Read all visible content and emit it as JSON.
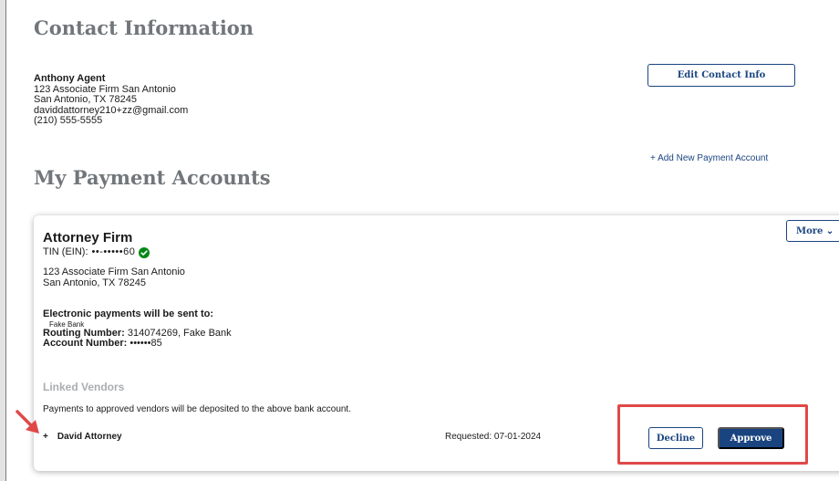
{
  "contact": {
    "heading": "Contact Information",
    "name": "Anthony Agent",
    "address_line1": "123 Associate Firm San Antonio",
    "address_line2": "San Antonio, TX 78245",
    "email": "daviddattorney210+zz@gmail.com",
    "phone": "(210) 555-5555",
    "edit_button": "Edit Contact Info"
  },
  "payments": {
    "heading": "My Payment Accounts",
    "add_link": "+ Add New Payment Account"
  },
  "account": {
    "name": "Attorney Firm",
    "tin_label": "TIN (EIN):",
    "tin_value": "••-•••••60",
    "verified_icon": "check-circle-icon",
    "address_line1": "123 Associate Firm San Antonio",
    "address_line2": "San Antonio, TX 78245",
    "payments_label": "Electronic payments will be sent to:",
    "bank_name_small": "Fake Bank",
    "routing_label": "Routing Number:",
    "routing_value": "314074269,  Fake Bank",
    "account_label": "Account Number:",
    "account_value": "••••••85",
    "more_button": "More ⌄"
  },
  "linked_vendors": {
    "title": "Linked Vendors",
    "note": "Payments to approved vendors will be deposited to the above bank account.",
    "vendor": {
      "expand_icon": "+",
      "name": "David Attorney",
      "requested": "Requested: 07-01-2024",
      "decline_button": "Decline",
      "approve_button": "Approve"
    }
  },
  "colors": {
    "primary": "#1a4480",
    "heading_gray": "#71767a",
    "annotation_red": "#e04848",
    "verified_green": "#008817"
  }
}
